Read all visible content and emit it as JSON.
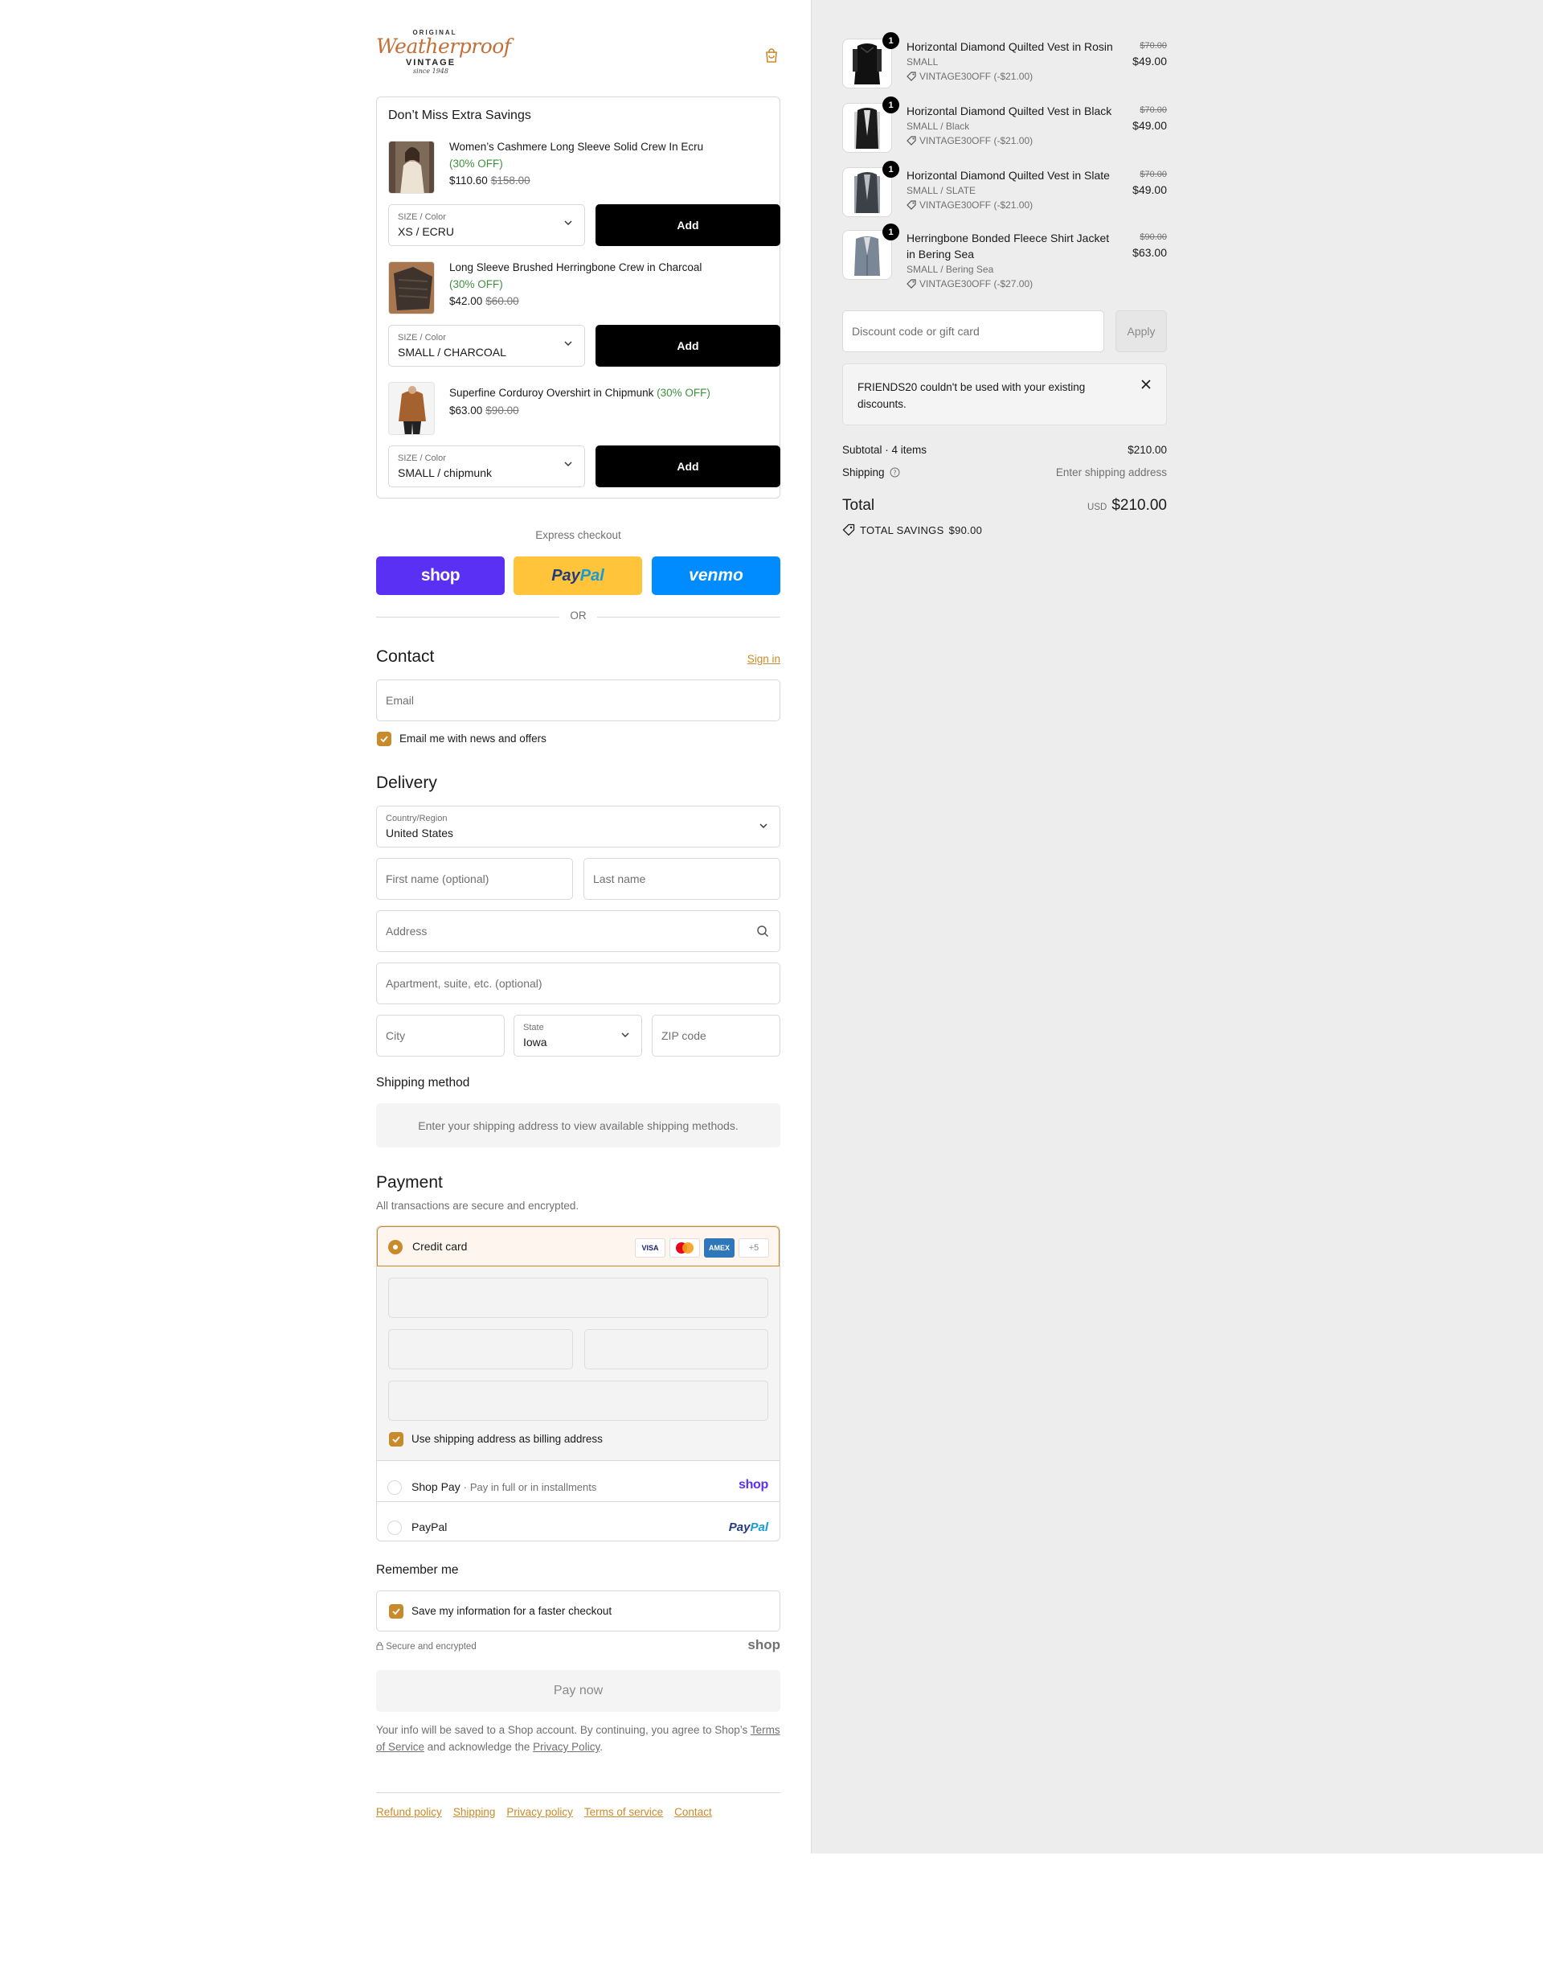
{
  "brand": {
    "top": "ORIGINAL",
    "script": "Weatherproof",
    "vintage": "VINTAGE",
    "since": "since 1948"
  },
  "upsell": {
    "title": "Don’t Miss Extra Savings",
    "items": [
      {
        "name": "Women’s Cashmere Long Sleeve Solid Crew In Ecru",
        "off": "(30% OFF)",
        "price": "$110.60",
        "old_price": "$158.00",
        "select_label": "SIZE / Color",
        "select_value": "XS / ECRU",
        "add_label": "Add"
      },
      {
        "name": "Long Sleeve Brushed Herringbone Crew in Charcoal",
        "off": "(30% OFF)",
        "price": "$42.00",
        "old_price": "$60.00",
        "select_label": "SIZE / Color",
        "select_value": "SMALL / CHARCOAL",
        "add_label": "Add"
      },
      {
        "name": "Superfine Corduroy Overshirt in Chipmunk",
        "off": "(30% OFF)",
        "price": "$63.00",
        "old_price": "$90.00",
        "select_label": "SIZE / Color",
        "select_value": "SMALL / chipmunk",
        "add_label": "Add"
      }
    ]
  },
  "express": {
    "label": "Express checkout",
    "shop": "shop",
    "paypal_a": "Pay",
    "paypal_b": "Pal",
    "venmo": "venmo",
    "or": "OR"
  },
  "contact": {
    "title": "Contact",
    "sign_in": "Sign in",
    "email_placeholder": "Email",
    "news_label": "Email me with news and offers"
  },
  "delivery": {
    "title": "Delivery",
    "country_label": "Country/Region",
    "country_value": "United States",
    "first_name": "First name (optional)",
    "last_name": "Last name",
    "address": "Address",
    "apartment": "Apartment, suite, etc. (optional)",
    "city": "City",
    "state_label": "State",
    "state_value": "Iowa",
    "zip": "ZIP code"
  },
  "shipping": {
    "title": "Shipping method",
    "note": "Enter your shipping address to view available shipping methods."
  },
  "payment": {
    "title": "Payment",
    "subtitle": "All transactions are secure and encrypted.",
    "credit_card": "Credit card",
    "card_visa": "VISA",
    "card_amex": "AMEX",
    "card_more": "+5",
    "billing_label": "Use shipping address as billing address",
    "shop_pay": "Shop Pay",
    "shop_pay_sub": "Pay in full or in installments",
    "shop_logo": "shop",
    "paypal": "PayPal",
    "paypal_logo_a": "Pay",
    "paypal_logo_b": "Pal"
  },
  "remember": {
    "title": "Remember me",
    "label": "Save my information for a faster checkout",
    "secure": "Secure and encrypted",
    "shop": "shop"
  },
  "pay_now": "Pay now",
  "legal": {
    "text1": "Your info will be saved to a Shop account. By continuing, you agree to Shop’s",
    "terms": "Terms of Service",
    "text2": "and acknowledge the",
    "privacy": "Privacy Policy",
    "text3": "."
  },
  "footer_links": [
    "Refund policy",
    "Shipping",
    "Privacy policy",
    "Terms of service",
    "Contact"
  ],
  "order": {
    "items": [
      {
        "qty": "1",
        "name": "Horizontal Diamond Quilted Vest in Rosin",
        "variant": "SMALL",
        "discount": "VINTAGE30OFF (-$21.00)",
        "old_price": "$70.00",
        "price": "$49.00"
      },
      {
        "qty": "1",
        "name": "Horizontal Diamond Quilted Vest in Black",
        "variant": "SMALL / Black",
        "discount": "VINTAGE30OFF (-$21.00)",
        "old_price": "$70.00",
        "price": "$49.00"
      },
      {
        "qty": "1",
        "name": "Horizontal Diamond Quilted Vest in Slate",
        "variant": "SMALL / SLATE",
        "discount": "VINTAGE30OFF (-$21.00)",
        "old_price": "$70.00",
        "price": "$49.00"
      },
      {
        "qty": "1",
        "name": "Herringbone Bonded Fleece Shirt Jacket in Bering Sea",
        "variant": "SMALL / Bering Sea",
        "discount": "VINTAGE30OFF (-$27.00)",
        "old_price": "$90.00",
        "price": "$63.00"
      }
    ],
    "discount_placeholder": "Discount code or gift card",
    "apply": "Apply",
    "notice": "FRIENDS20 couldn't be used with your existing discounts.",
    "subtotal_label": "Subtotal · 4 items",
    "subtotal_value": "$210.00",
    "shipping_label": "Shipping",
    "shipping_value": "Enter shipping address",
    "total_label": "Total",
    "currency": "USD",
    "total_value": "$210.00",
    "savings_label": "TOTAL SAVINGS",
    "savings_value": "$90.00"
  },
  "colors": {
    "accent": "#c98a2c",
    "shop": "#5a31f4",
    "paypal": "#ffc439",
    "venmo": "#008cff"
  }
}
